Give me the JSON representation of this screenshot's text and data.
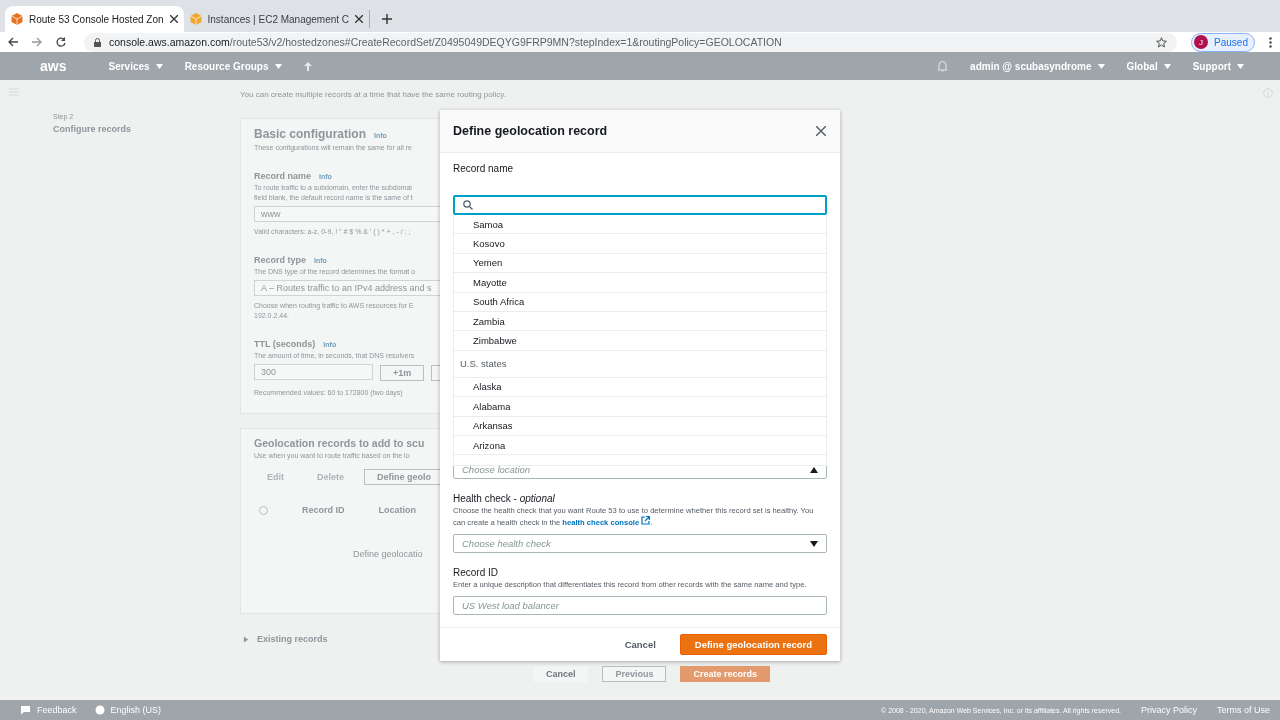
{
  "browser": {
    "tabs": [
      {
        "title": "Route 53 Console Hosted Zon",
        "selected": true
      },
      {
        "title": "Instances | EC2 Management C",
        "selected": false
      }
    ],
    "url_host": "console.aws.amazon.com",
    "url_path": "/route53/v2/hostedzones#CreateRecordSet/Z0495049DEQYG9FRP9MN?stepIndex=1&routingPolicy=GEOLOCATION",
    "profile": {
      "initial": "J",
      "status": "Paused"
    }
  },
  "console_nav": {
    "logo": "aws",
    "menus": [
      "Services",
      "Resource Groups"
    ],
    "right_menus": [
      "admin @ scubasyndrome",
      "Global",
      "Support"
    ]
  },
  "wizard_steps": [
    {
      "step": "Step 2",
      "title": "Configure records"
    }
  ],
  "intro": "You can create multiple records at a time that have the same routing policy.",
  "basic_configuration": {
    "title": "Basic configuration",
    "info": "Info",
    "description": "These configurations will remain the same for all re",
    "fields": [
      {
        "kind": "input",
        "label": "Record name",
        "info": "Info",
        "description": [
          "To route traffic to a subdomain, enter the subdomai",
          "field blank, the default record name is the same of t"
        ],
        "value": "www",
        "hint": [
          "Valid characters: a-z, 0-9, ! \" # $ % & ' ( ) * + , - / : ;"
        ]
      },
      {
        "kind": "select",
        "label": "Record type",
        "info": "Info",
        "description": [
          "The DNS type of the record determines the format o"
        ],
        "value": "A – Routes traffic to an IPv4 address and s",
        "hint": [
          "Choose when routing traffic to AWS resources for E",
          "192.0.2.44."
        ]
      },
      {
        "kind": "ttl",
        "label": "TTL (seconds)",
        "info": "Info",
        "description": [
          "The amount of time, in seconds, that DNS resolvers"
        ],
        "value": "300",
        "button": "+1m",
        "hint": [
          "Recommended values: 60 to 172800 (two days)"
        ]
      }
    ]
  },
  "geolocation_records": {
    "title": "Geolocation records to add to scu",
    "description": "Use when you want to route traffic based on the lo",
    "buttons": [
      {
        "label": "Edit",
        "disabled": true
      },
      {
        "label": "Delete",
        "disabled": true
      },
      {
        "label": "Define geolo",
        "disabled": false
      }
    ],
    "all_selected": false,
    "columns": [
      "Record ID",
      "Location"
    ],
    "empty_text": "Define geolocatio"
  },
  "existing_records": {
    "label": "Existing records",
    "expanded": false
  },
  "actions": [
    {
      "label": "Cancel",
      "kind": "link"
    },
    {
      "label": "Previous",
      "kind": "normal"
    },
    {
      "label": "Create records",
      "kind": "primary"
    }
  ],
  "footer": {
    "feedback": "Feedback",
    "language": "English (US)",
    "copyright": "© 2008 - 2020, Amazon Web Services, Inc. or its affiliates. All rights reserved.",
    "links": [
      "Privacy Policy",
      "Terms of Use"
    ]
  },
  "modal": {
    "title": "Define geolocation record",
    "record_name_label": "Record name",
    "location": {
      "placeholder": "Choose location",
      "expanded": true,
      "options": [
        {
          "label": "Samoa",
          "kind": "option"
        },
        {
          "label": "Kosovo",
          "kind": "option"
        },
        {
          "label": "Yemen",
          "kind": "option"
        },
        {
          "label": "Mayotte",
          "kind": "option"
        },
        {
          "label": "South Africa",
          "kind": "option"
        },
        {
          "label": "Zambia",
          "kind": "option"
        },
        {
          "label": "Zimbabwe",
          "kind": "option"
        },
        {
          "label": "U.S. states",
          "kind": "group"
        },
        {
          "label": "Alaska",
          "kind": "option"
        },
        {
          "label": "Alabama",
          "kind": "option"
        },
        {
          "label": "Arkansas",
          "kind": "option"
        },
        {
          "label": "Arizona",
          "kind": "option"
        }
      ]
    },
    "health_check": {
      "label": "Health check - *optional*",
      "description": "Choose the health check that you want Route 53 to use to determine whether this record set is healthy. You can create a health check in the",
      "link": "health check console",
      "after": ".",
      "placeholder": "Choose health check"
    },
    "record_id": {
      "label": "Record ID",
      "description": "Enter a unique description that differentiates this record from other records with the same name and type.",
      "placeholder": "US West load balancer"
    },
    "buttons": [
      {
        "label": "Cancel",
        "kind": "link"
      },
      {
        "label": "Define geolocation record",
        "kind": "primary"
      }
    ]
  }
}
